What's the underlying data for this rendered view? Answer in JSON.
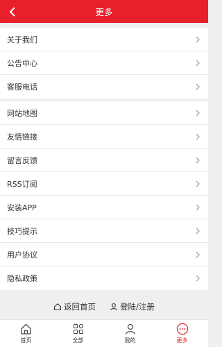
{
  "header": {
    "title": "更多"
  },
  "group1": [
    {
      "label": "关于我们"
    },
    {
      "label": "公告中心"
    },
    {
      "label": "客服电话"
    }
  ],
  "group2": [
    {
      "label": "网站地图"
    },
    {
      "label": "友情链接"
    },
    {
      "label": "留言反馈"
    },
    {
      "label": "RSS订阅"
    },
    {
      "label": "安装APP"
    },
    {
      "label": "技巧提示"
    },
    {
      "label": "用户协议"
    },
    {
      "label": "隐私政策"
    }
  ],
  "footer_links": {
    "home": "返回首页",
    "login": "登陆/注册"
  },
  "tabbar": {
    "items": [
      {
        "label": "首页",
        "icon": "home-icon"
      },
      {
        "label": "全部",
        "icon": "grid-icon"
      },
      {
        "label": "我的",
        "icon": "user-icon"
      },
      {
        "label": "更多",
        "icon": "more-icon"
      }
    ],
    "active_index": 3
  },
  "colors": {
    "accent": "#e8202a"
  }
}
